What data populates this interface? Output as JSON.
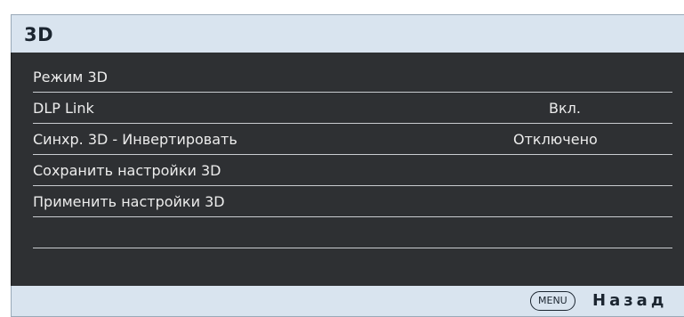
{
  "header": {
    "title": "3D"
  },
  "menu": {
    "items": [
      {
        "label": "Режим 3D",
        "value": ""
      },
      {
        "label": "DLP Link",
        "value": "Вкл."
      },
      {
        "label": "Синхр. 3D - Инвертировать",
        "value": "Отключено"
      },
      {
        "label": "Сохранить настройки 3D",
        "value": ""
      },
      {
        "label": "Применить настройки 3D",
        "value": ""
      },
      {
        "label": "",
        "value": ""
      }
    ]
  },
  "footer": {
    "menu_key": "MENU",
    "back_label": "Назад"
  },
  "colors": {
    "header_bg": "#d9e4ef",
    "panel_bg": "#2e3033",
    "text_light": "#ececec",
    "divider": "#c9ccd0",
    "text_dark": "#1b2530"
  }
}
